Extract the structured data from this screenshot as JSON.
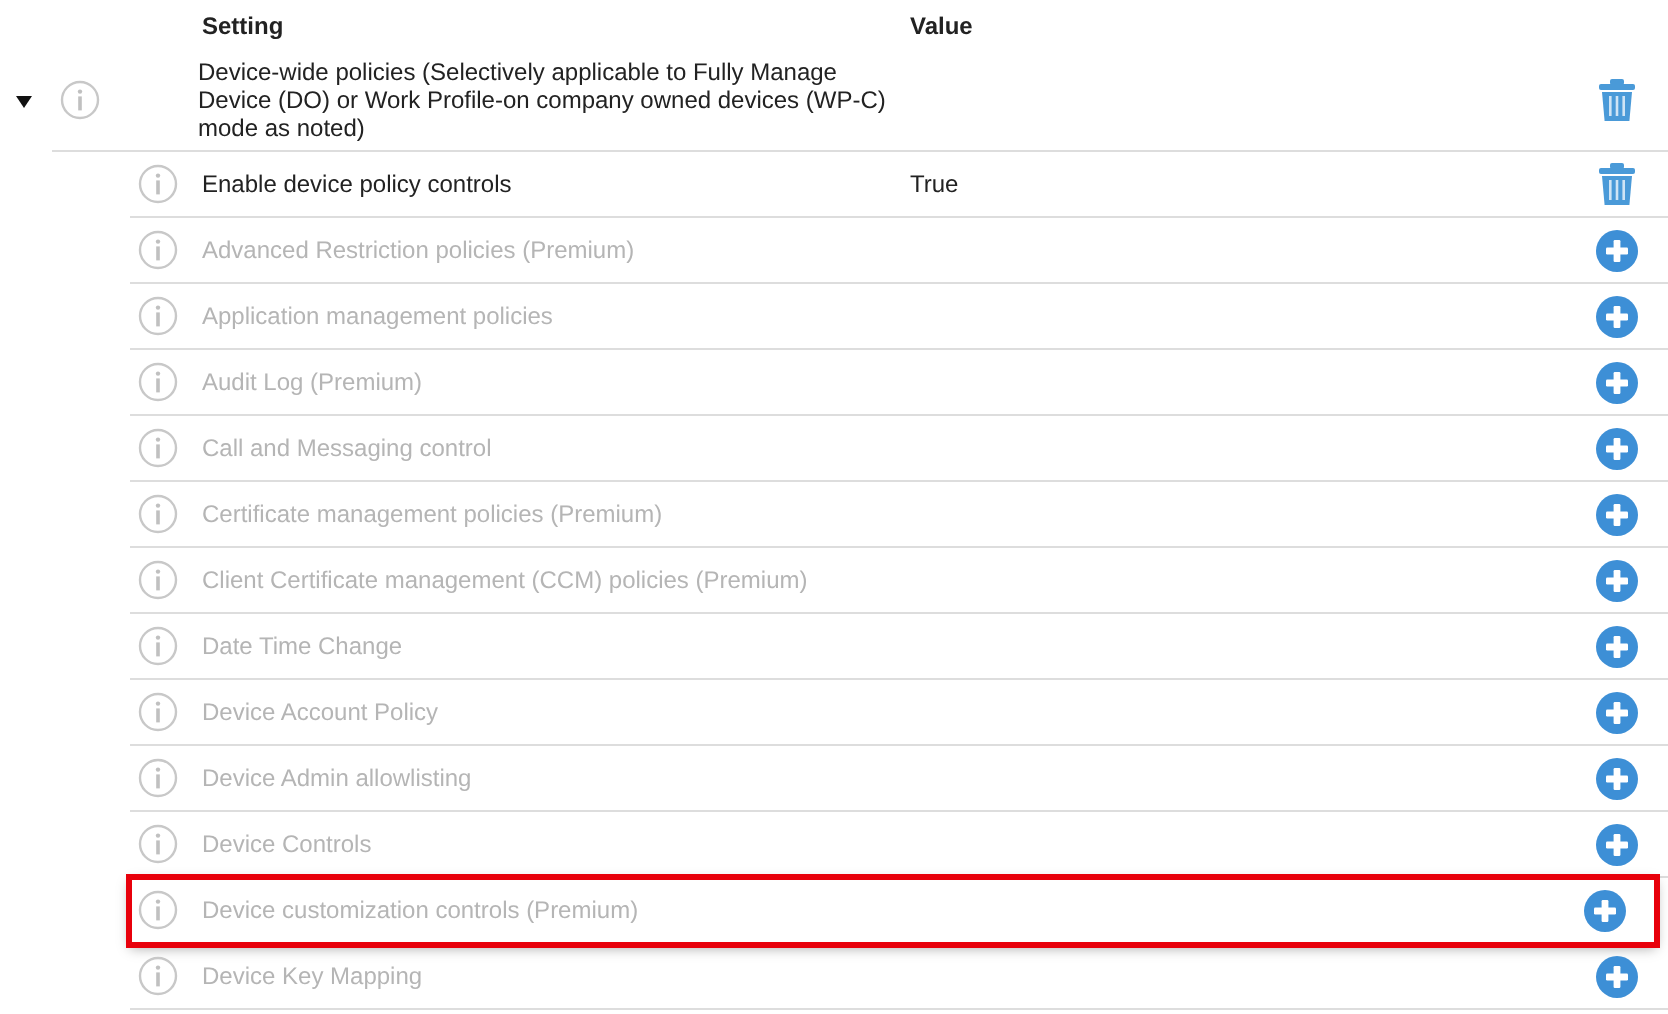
{
  "columns": {
    "setting": "Setting",
    "value": "Value"
  },
  "group": {
    "label": "Device-wide policies (Selectively applicable to Fully Manage Device (DO) or Work Profile-on company owned devices (WP-C) mode as noted)",
    "expanded": true,
    "kind": "delete"
  },
  "rows": [
    {
      "label": "Enable device policy controls",
      "value": "True",
      "enabled": true,
      "kind": "delete",
      "highlighted": false
    },
    {
      "label": "Advanced Restriction policies (Premium)",
      "enabled": false,
      "kind": "add",
      "highlighted": false
    },
    {
      "label": "Application management policies",
      "enabled": false,
      "kind": "add",
      "highlighted": false
    },
    {
      "label": "Audit Log (Premium)",
      "enabled": false,
      "kind": "add",
      "highlighted": false
    },
    {
      "label": "Call and Messaging control",
      "enabled": false,
      "kind": "add",
      "highlighted": false
    },
    {
      "label": "Certificate management policies (Premium)",
      "enabled": false,
      "kind": "add",
      "highlighted": false
    },
    {
      "label": "Client Certificate management (CCM) policies (Premium)",
      "enabled": false,
      "kind": "add",
      "highlighted": false
    },
    {
      "label": "Date Time Change",
      "enabled": false,
      "kind": "add",
      "highlighted": false
    },
    {
      "label": "Device Account Policy",
      "enabled": false,
      "kind": "add",
      "highlighted": false
    },
    {
      "label": "Device Admin allowlisting",
      "enabled": false,
      "kind": "add",
      "highlighted": false
    },
    {
      "label": "Device Controls",
      "enabled": false,
      "kind": "add",
      "highlighted": false
    },
    {
      "label": "Device customization controls (Premium)",
      "enabled": false,
      "kind": "add",
      "highlighted": true
    },
    {
      "label": "Device Key Mapping",
      "enabled": false,
      "kind": "add",
      "highlighted": false
    }
  ]
}
